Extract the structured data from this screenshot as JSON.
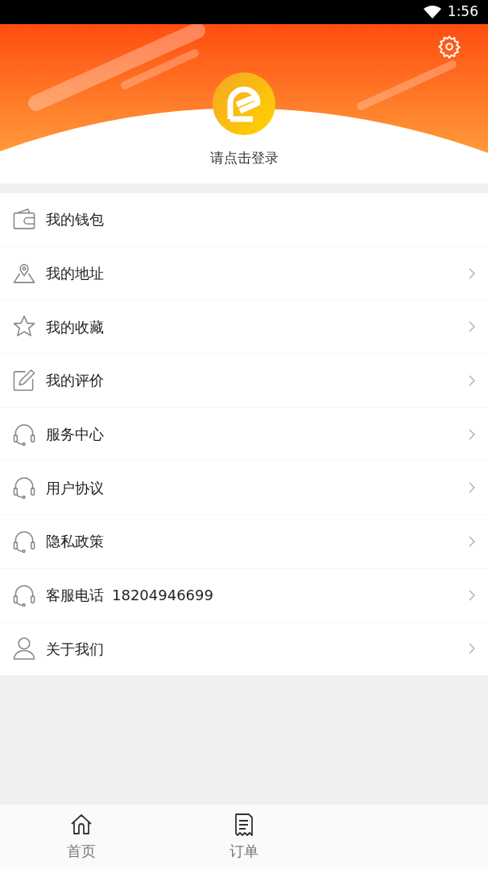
{
  "status_bar": {
    "time": "1:56"
  },
  "header": {
    "login_prompt": "请点击登录"
  },
  "menu": [
    {
      "kind": "wallet",
      "label": "我的钱包",
      "chevron": false
    },
    {
      "kind": "location",
      "label": "我的地址",
      "chevron": true
    },
    {
      "kind": "star",
      "label": "我的收藏",
      "chevron": true
    },
    {
      "kind": "edit",
      "label": "我的评价",
      "chevron": true
    },
    {
      "kind": "headset",
      "label": "服务中心",
      "chevron": true
    },
    {
      "kind": "headset",
      "label": "用户协议",
      "chevron": true
    },
    {
      "kind": "headset",
      "label": "隐私政策",
      "chevron": true
    },
    {
      "kind": "headset",
      "label": "客服电话",
      "value": "18204946699",
      "chevron": true
    },
    {
      "kind": "person",
      "label": "关于我们",
      "chevron": true
    }
  ],
  "tabs": [
    {
      "kind": "home",
      "label": "首页",
      "selected": false
    },
    {
      "kind": "receipt",
      "label": "订单",
      "selected": false
    }
  ]
}
